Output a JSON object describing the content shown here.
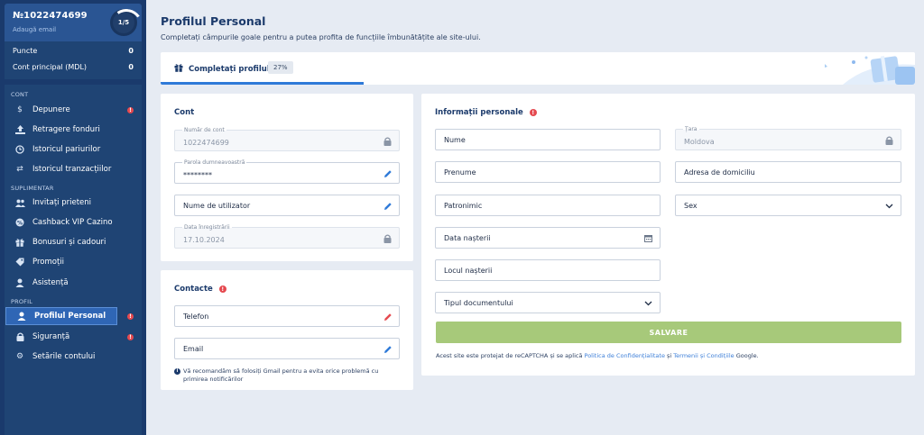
{
  "account": {
    "id": "№1022474699",
    "add_email": "Adaugă email",
    "level": "1/5"
  },
  "balances": [
    {
      "label": "Puncte",
      "value": "0"
    },
    {
      "label": "Cont principal (MDL)",
      "value": "0"
    }
  ],
  "nav": {
    "sec_cont": "CONT",
    "sec_supl": "SUPLIMENTAR",
    "sec_profil": "PROFIL",
    "items": [
      {
        "label": "Depunere",
        "icon": "dollar-icon"
      },
      {
        "label": "Retragere fonduri",
        "icon": "upload-icon"
      },
      {
        "label": "Istoricul pariurilor",
        "icon": "clock-icon"
      },
      {
        "label": "Istoricul tranzacțiilor",
        "icon": "transfer-icon"
      },
      {
        "label": "Invitați prieteni",
        "icon": "users-icon"
      },
      {
        "label": "Cashback VIP Cazino",
        "icon": "cashback-icon"
      },
      {
        "label": "Bonusuri și cadouri",
        "icon": "gift-icon"
      },
      {
        "label": "Promoții",
        "icon": "tag-icon"
      },
      {
        "label": "Asistență",
        "icon": "support-icon"
      },
      {
        "label": "Profilul Personal",
        "icon": "user-icon"
      },
      {
        "label": "Siguranță",
        "icon": "lock-icon"
      },
      {
        "label": "Setările contului",
        "icon": "gear-icon"
      }
    ],
    "alert_mark": "!"
  },
  "page": {
    "title": "Profilul Personal",
    "subtitle": "Completați câmpurile goale pentru a putea profita de funcțiile îmbunătățite ale site-ului."
  },
  "progress": {
    "label": "Completați profilul",
    "percent_text": "27%",
    "percent": 27
  },
  "cont": {
    "title": "Cont",
    "account_number": {
      "label": "Număr de cont",
      "value": "1022474699"
    },
    "password": {
      "label": "Parola dumneavoastră",
      "value": "********"
    },
    "username": {
      "placeholder": "Nume de utilizator"
    },
    "reg_date": {
      "label": "Data înregistrării",
      "value": "17.10.2024"
    }
  },
  "contacte": {
    "title": "Contacte",
    "phone": {
      "placeholder": "Telefon"
    },
    "email": {
      "placeholder": "Email"
    },
    "note": "Vă recomandăm să folosiți Gmail pentru a evita orice problemă cu primirea notificărilor",
    "note_icon": "i"
  },
  "personal": {
    "title": "Informații personale",
    "nume": "Nume",
    "prenume": "Prenume",
    "patronimic": "Patronimic",
    "data_nasterii": "Data nașterii",
    "locul_nasterii": "Locul nașterii",
    "tipul_doc": "Tipul documentului",
    "tara": {
      "label": "Țara",
      "value": "Moldova"
    },
    "adresa": "Adresa de domiciliu",
    "sex": "Sex",
    "save": "SALVARE",
    "captcha_pre": "Acest site este protejat de reCAPTCHA și se aplică ",
    "captcha_link1": "Politica de Confidențialitate",
    "captcha_mid": " și ",
    "captcha_link2": "Termenii și Condițiile",
    "captcha_post": " Google."
  },
  "colors": {
    "sidebar": "#1a3a6c",
    "accent": "#2f7ad8",
    "save": "#a7c97a",
    "alert": "#e5494f"
  }
}
